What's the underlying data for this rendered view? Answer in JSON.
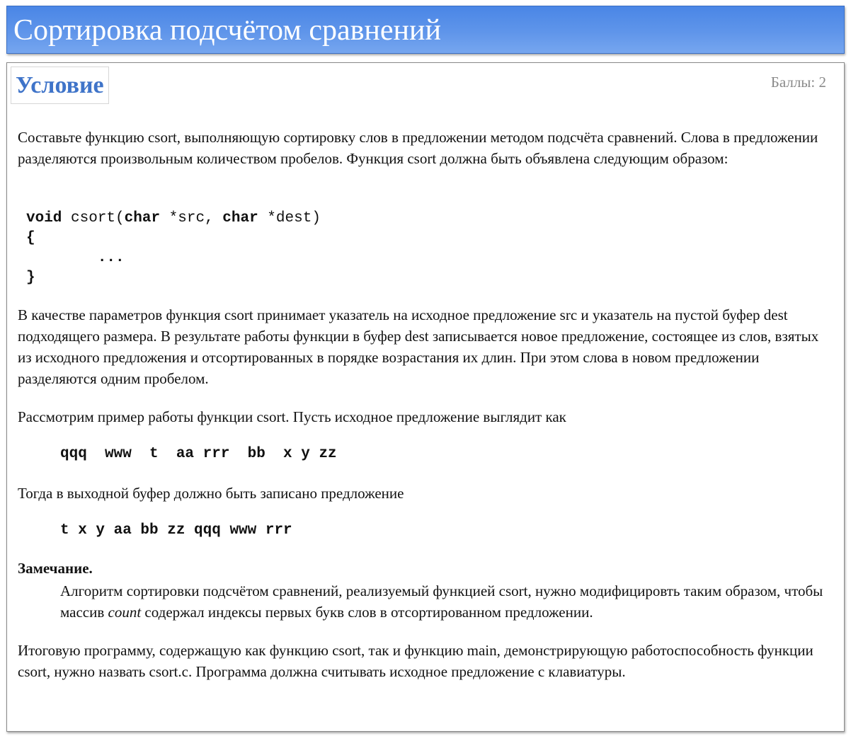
{
  "page": {
    "title": "Сортировка подсчётом сравнений"
  },
  "section": {
    "title": "Условие",
    "score": "Баллы: 2"
  },
  "content": {
    "intro": "Составьте функцию csort, выполняющую сортировку слов в предложении методом подсчёта сравнений. Слова в предложении разделяются произвольным количеством пробелов. Функция csort должна быть объявлена следующим образом:",
    "code": {
      "kw_void": "void",
      "name": " csort(",
      "kw_char1": "char",
      "arg1": " *src, ",
      "kw_char2": "char",
      "arg2": " *dest)",
      "open_brace": "{",
      "ellipsis": "        ...",
      "close_brace": "}"
    },
    "params": "В качестве параметров функция csort принимает указатель на исходное предложение src и указатель на пустой буфер dest подходящего размера. В результате работы функции в буфер dest записывается новое предложение, состоящее из слов, взятых из исходного предложения и отсортированных в порядке возрастания их длин. При этом слова в новом предложении разделяются одним пробелом.",
    "example_intro": "Рассмотрим пример работы функции csort. Пусть исходное предложение выглядит как",
    "example_input": "qqq  www  t  aa rrr  bb  x y zz",
    "output_intro": "Тогда в выходной буфер должно быть записано предложение",
    "example_output": "t x y aa bb zz qqq www rrr",
    "note_heading": "Замечание.",
    "note_part1": "Алгоритм сортировки подсчётом сравнений, реализуемый функцией csort, нужно модифицировть таким образом, чтобы массив ",
    "note_italic": "count",
    "note_part2": " содержал индексы первых букв слов в отсортированном предложении.",
    "final": "Итоговую программу, содержащую как функцию csort, так и функцию main, демонстрирующую работоспособность функции csort, нужно назвать csort.c. Программа должна считывать исходное предложение с клавиатуры."
  }
}
